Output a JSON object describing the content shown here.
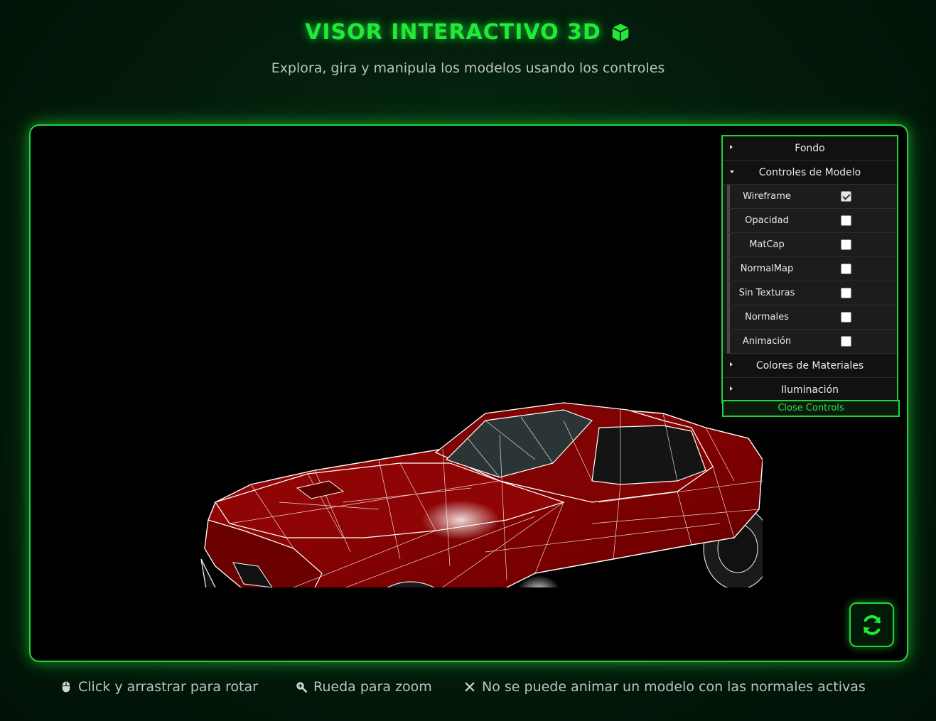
{
  "header": {
    "title": "VISOR INTERACTIVO 3D",
    "subtitle": "Explora, gira y manipula los modelos usando los controles"
  },
  "gui": {
    "folders": {
      "fondo": "Fondo",
      "controles": "Controles de Modelo",
      "colores": "Colores de Materiales",
      "iluminacion": "Iluminación"
    },
    "controls": [
      {
        "label": "Wireframe",
        "checked": true
      },
      {
        "label": "Opacidad",
        "checked": false
      },
      {
        "label": "MatCap",
        "checked": false
      },
      {
        "label": "NormalMap",
        "checked": false
      },
      {
        "label": "Sin Texturas",
        "checked": false
      },
      {
        "label": "Normales",
        "checked": false
      },
      {
        "label": "Animación",
        "checked": false
      }
    ],
    "close_label": "Close Controls"
  },
  "footer": {
    "hint_rotate": "Click y arrastrar para rotar",
    "hint_zoom": "Rueda para zoom",
    "hint_warning": "No se puede animar un modelo con las normales activas"
  },
  "icons": {
    "title_icon": "cube-icon",
    "refresh": "refresh-icon",
    "mouse": "mouse-icon",
    "zoom": "zoom-icon",
    "close": "close-icon"
  },
  "colors": {
    "accent": "#23d43a",
    "car_body": "#8b0000",
    "wire": "#ffffff"
  }
}
